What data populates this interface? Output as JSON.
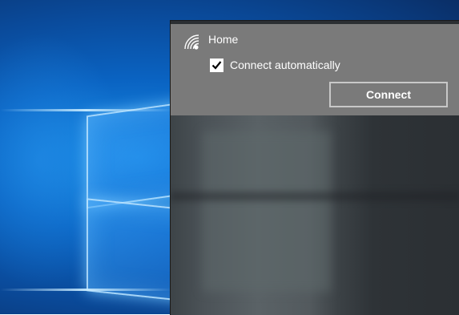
{
  "network": {
    "name": "Home",
    "icon": "wifi-secured-icon",
    "connect_automatically": {
      "label": "Connect automatically",
      "checked": true
    },
    "connect_button_label": "Connect"
  },
  "colors": {
    "flyout_item_bg": "#7a7a7a",
    "flyout_bg": "#2b2f33",
    "desktop_accent": "#0a63c2",
    "button_border": "#c8c8c8"
  }
}
